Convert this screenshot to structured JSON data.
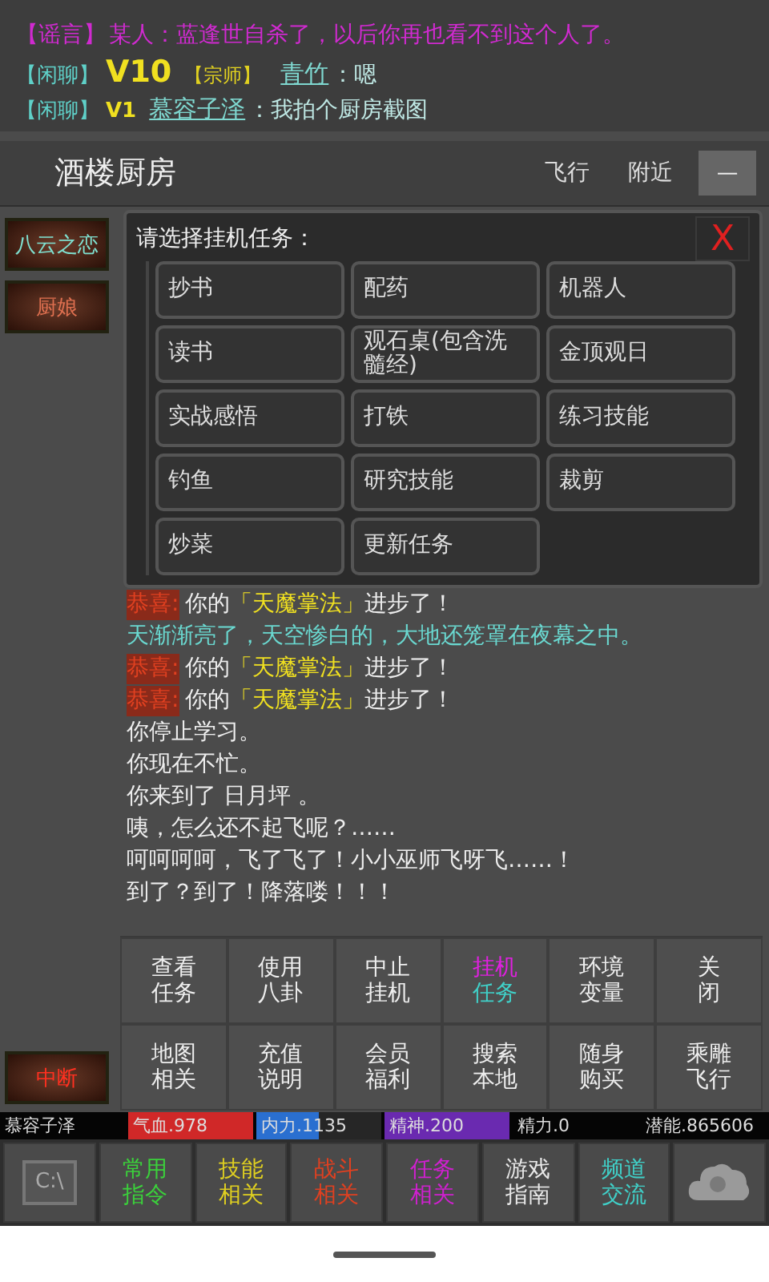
{
  "chat": [
    {
      "channel": "【谣言】",
      "kind": "rumor",
      "text": "某人：蓝逢世自杀了，以后你再也看不到这个人了。"
    },
    {
      "channel": "【闲聊】",
      "kind": "chat",
      "vip": "V10",
      "title": "【宗师】",
      "name": "青竹",
      "text": "：嗯"
    },
    {
      "channel": "【闲聊】",
      "kind": "chat",
      "vip": "V1",
      "name": "慕容子泽",
      "text": "：我拍个厨房截图"
    }
  ],
  "header": {
    "title": "酒楼厨房",
    "actions": [
      "飞行",
      "附近"
    ],
    "menu": "—"
  },
  "npcs": [
    {
      "label": "八云之恋",
      "kind": "player"
    },
    {
      "label": "厨娘",
      "kind": "npc"
    }
  ],
  "dialog": {
    "title": "请选择挂机任务：",
    "close": "X",
    "options": [
      "抄书",
      "配药",
      "机器人",
      "读书",
      "观石桌(包含洗髓经)",
      "金顶观日",
      "实战感悟",
      "打铁",
      "练习技能",
      "钓鱼",
      "研究技能",
      "裁剪",
      "炒菜",
      "更新任务"
    ]
  },
  "log": [
    [
      {
        "kind": "tag",
        "text": "恭喜:"
      },
      {
        "kind": "plain",
        "text": "你的"
      },
      {
        "kind": "skill",
        "text": "「天魔掌法」"
      },
      {
        "kind": "plain",
        "text": "进步了！"
      }
    ],
    [
      {
        "kind": "scene",
        "text": "天渐渐亮了，天空惨白的，大地还笼罩在夜幕之中。"
      }
    ],
    [
      {
        "kind": "tag",
        "text": "恭喜:"
      },
      {
        "kind": "plain",
        "text": "你的"
      },
      {
        "kind": "skill",
        "text": "「天魔掌法」"
      },
      {
        "kind": "plain",
        "text": "进步了！"
      }
    ],
    [
      {
        "kind": "tag",
        "text": "恭喜:"
      },
      {
        "kind": "plain",
        "text": "你的"
      },
      {
        "kind": "skill",
        "text": "「天魔掌法」"
      },
      {
        "kind": "plain",
        "text": "进步了！"
      }
    ],
    [
      {
        "kind": "plain",
        "text": "你停止学习。"
      }
    ],
    [
      {
        "kind": "plain",
        "text": "你现在不忙。"
      }
    ],
    [
      {
        "kind": "plain",
        "text": "你来到了 日月坪 。"
      }
    ],
    [
      {
        "kind": "plain",
        "text": "咦，怎么还不起飞呢？……"
      }
    ],
    [
      {
        "kind": "plain",
        "text": "呵呵呵呵，飞了飞了！小小巫师飞呀飞……！"
      }
    ],
    [
      {
        "kind": "plain",
        "text": "到了？到了！降落喽！！！"
      }
    ]
  ],
  "interrupt": "中断",
  "commands": [
    {
      "lines": [
        "查看",
        "任务"
      ],
      "selected": false
    },
    {
      "lines": [
        "使用",
        "八卦"
      ],
      "selected": false
    },
    {
      "lines": [
        "中止",
        "挂机"
      ],
      "selected": false
    },
    {
      "lines": [
        "挂机",
        "任务"
      ],
      "selected": true
    },
    {
      "lines": [
        "环境",
        "变量"
      ],
      "selected": false
    },
    {
      "lines": [
        "关",
        "闭"
      ],
      "selected": false
    },
    {
      "lines": [
        "地图",
        "相关"
      ],
      "selected": false
    },
    {
      "lines": [
        "充值",
        "说明"
      ],
      "selected": false
    },
    {
      "lines": [
        "会员",
        "福利"
      ],
      "selected": false
    },
    {
      "lines": [
        "搜索",
        "本地"
      ],
      "selected": false
    },
    {
      "lines": [
        "随身",
        "购买"
      ],
      "selected": false
    },
    {
      "lines": [
        "乘雕",
        "飞行"
      ],
      "selected": false
    }
  ],
  "stats": [
    {
      "kind": "name",
      "text": "慕容子泽"
    },
    {
      "kind": "bar",
      "text": "气血.978",
      "color": "#d02828",
      "level": 1
    },
    {
      "kind": "bar",
      "text": "内力.1135",
      "color": "#2a6fd0",
      "level": 0.5
    },
    {
      "kind": "bar",
      "text": "精神.200",
      "color": "#6a2ab0",
      "level": 1
    },
    {
      "kind": "plain",
      "text": "精力.0"
    },
    {
      "kind": "plain",
      "text": "潜能.865606"
    }
  ],
  "tabs": [
    {
      "kind": "console",
      "label": "C:\\"
    },
    {
      "kind": "text",
      "lines": [
        "常用",
        "指令"
      ],
      "color": "#3bd13b"
    },
    {
      "kind": "text",
      "lines": [
        "技能",
        "相关"
      ],
      "color": "#e0d020"
    },
    {
      "kind": "text",
      "lines": [
        "战斗",
        "相关"
      ],
      "color": "#e04020"
    },
    {
      "kind": "text",
      "lines": [
        "任务",
        "相关"
      ],
      "color": "#d020d0"
    },
    {
      "kind": "text",
      "lines": [
        "游戏",
        "指南"
      ],
      "color": "#e8e8e8"
    },
    {
      "kind": "text",
      "lines": [
        "频道",
        "交流"
      ],
      "color": "#40d0c8"
    },
    {
      "kind": "cloud"
    }
  ]
}
